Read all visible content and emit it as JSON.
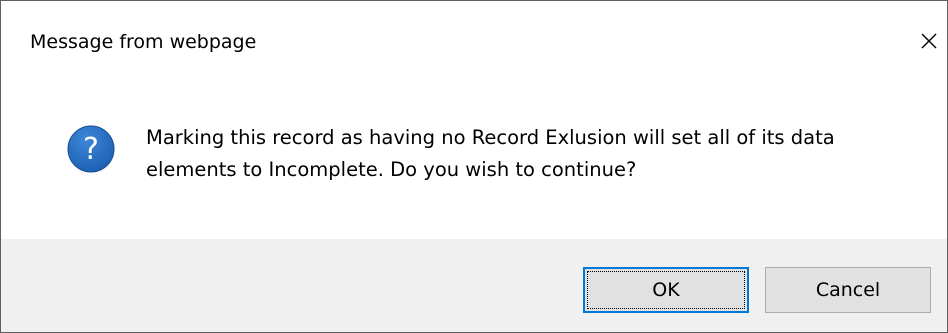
{
  "dialog": {
    "title": "Message from webpage",
    "close_icon": "close-icon",
    "message_icon": "question-icon",
    "message": "Marking this record as having no Record Exlusion will set all of its data\nelements to Incomplete.  Do you wish to continue?",
    "buttons": {
      "ok_label": "OK",
      "cancel_label": "Cancel"
    },
    "colors": {
      "icon_blue": "#1c5fb1",
      "focus_border": "#0078d7",
      "footer_bg": "#f0f0f0",
      "button_bg": "#e1e1e1"
    }
  }
}
